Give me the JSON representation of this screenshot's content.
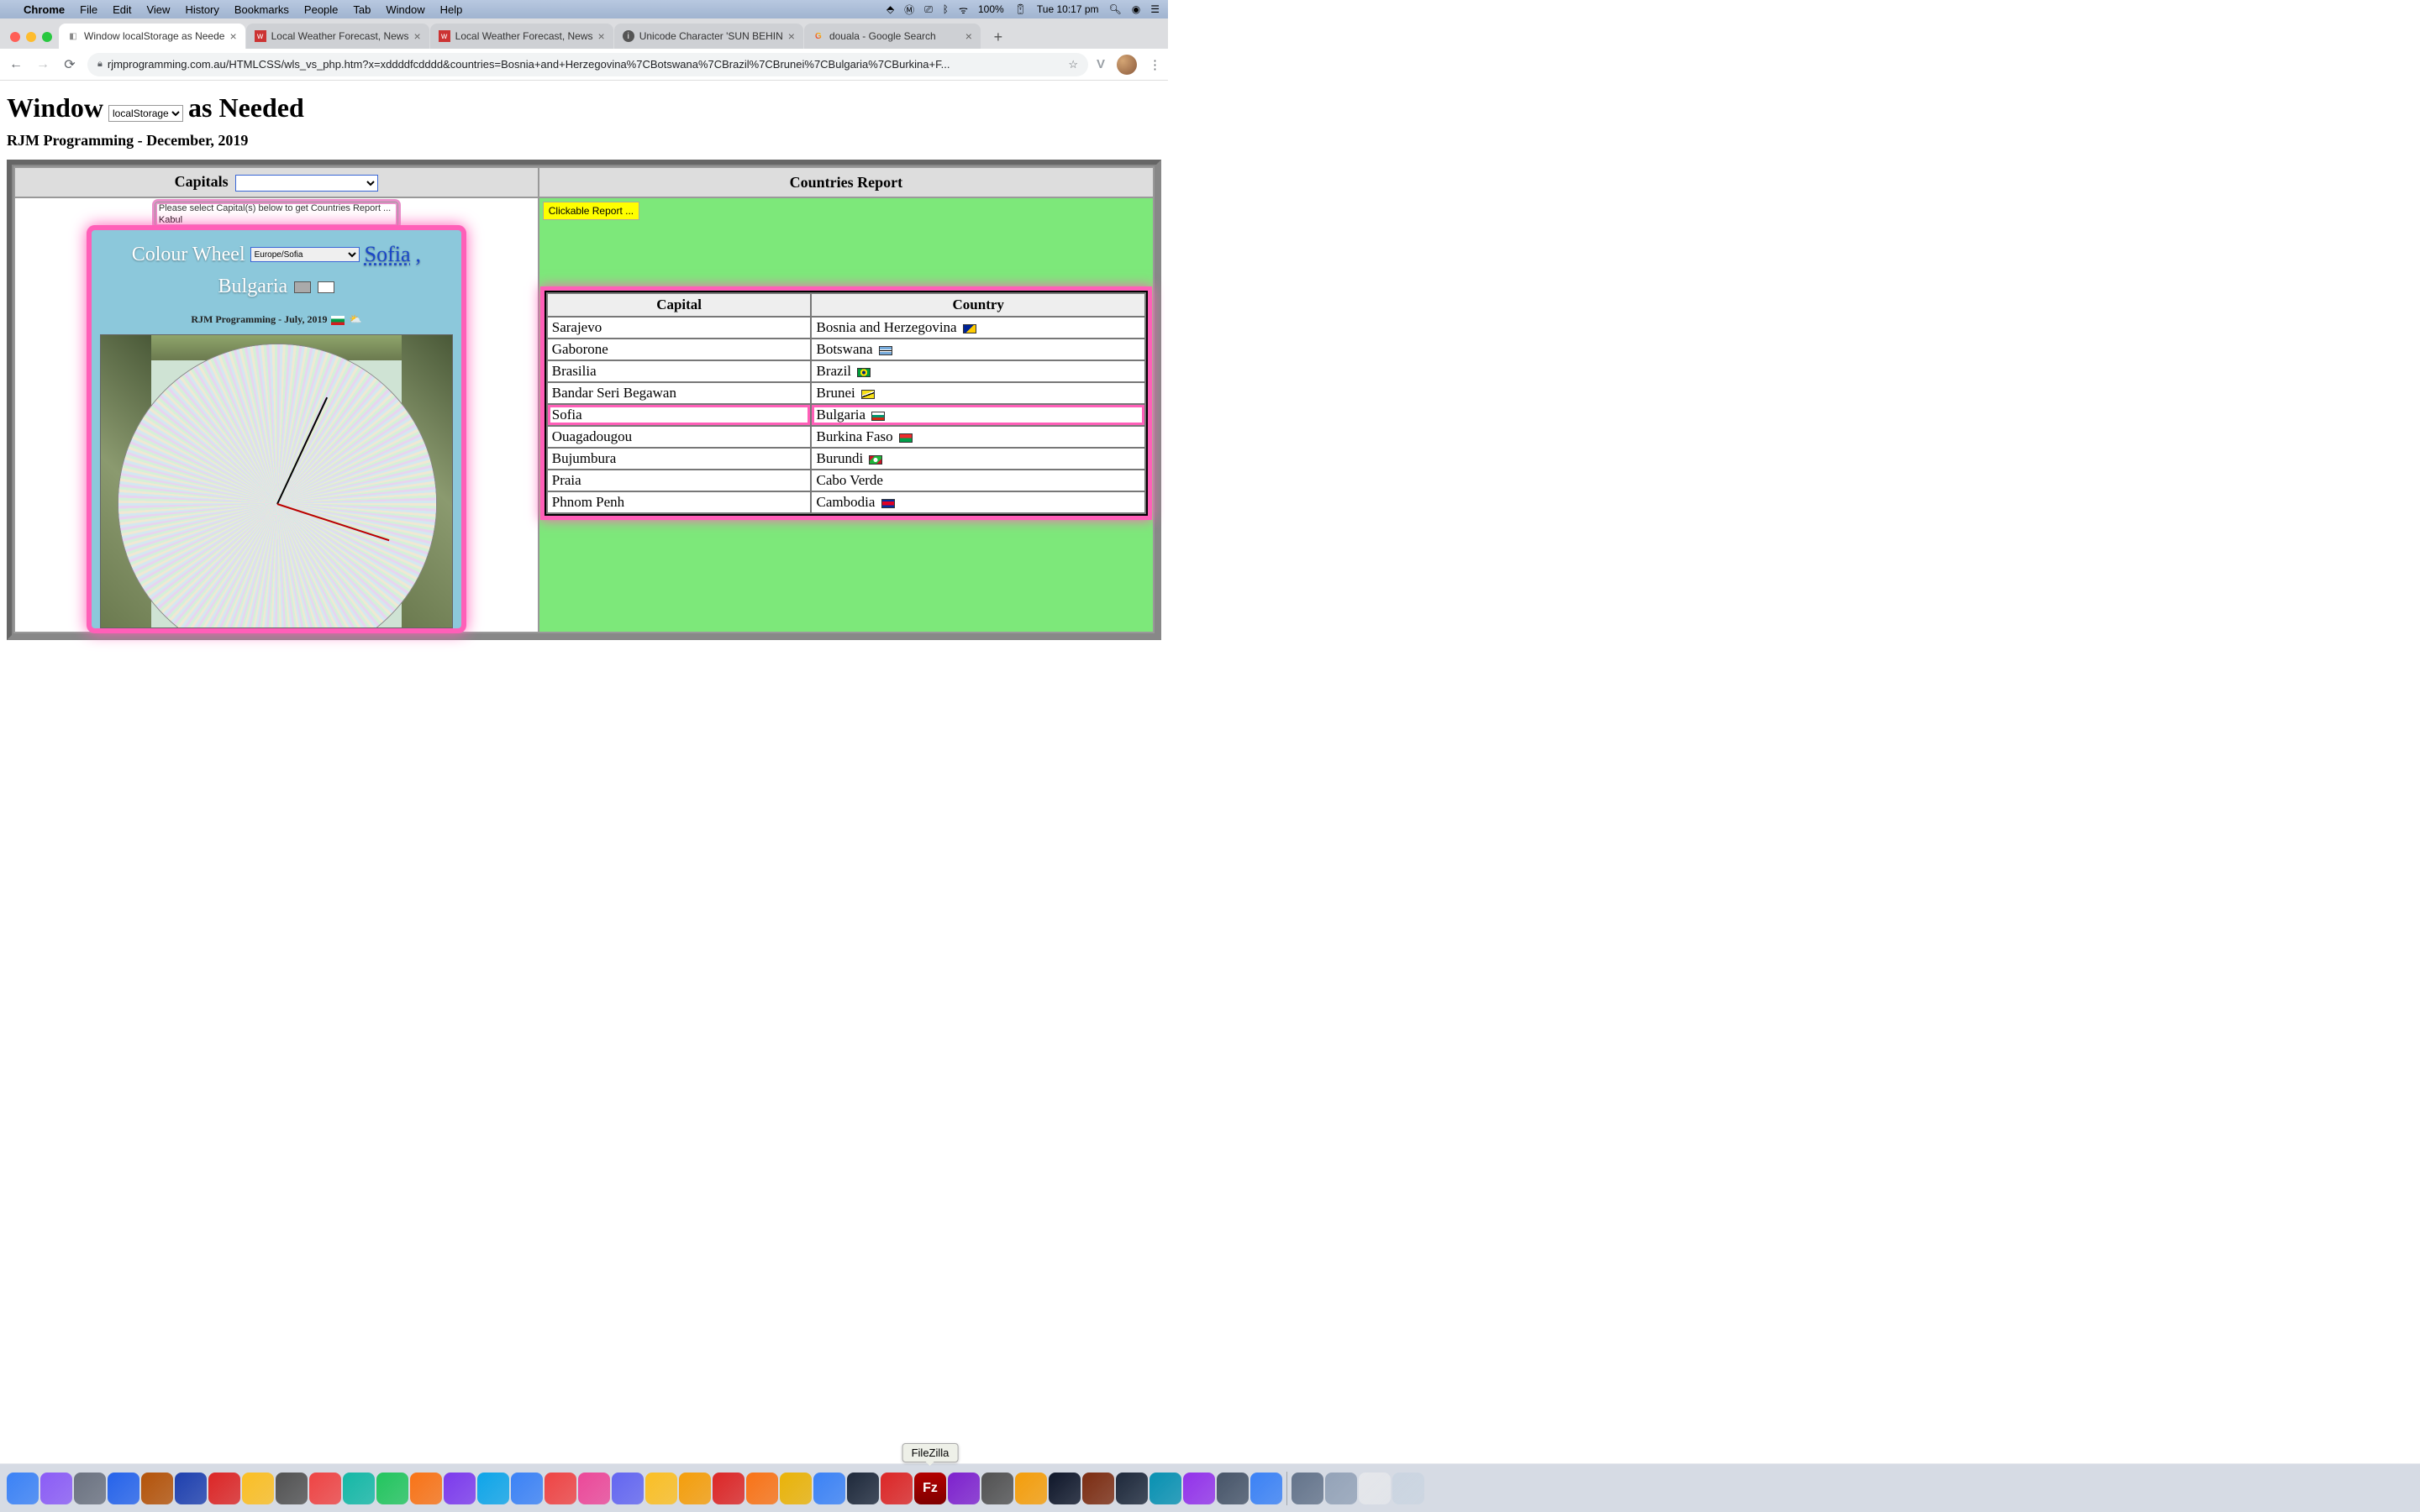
{
  "menubar": {
    "app": "Chrome",
    "items": [
      "File",
      "Edit",
      "View",
      "History",
      "Bookmarks",
      "People",
      "Tab",
      "Window",
      "Help"
    ],
    "battery": "100%",
    "clock": "Tue 10:17 pm"
  },
  "tabs": [
    {
      "label": "Window localStorage as Neede",
      "active": true,
      "icon": "page"
    },
    {
      "label": "Local Weather Forecast, News",
      "active": false,
      "icon": "wu"
    },
    {
      "label": "Local Weather Forecast, News",
      "active": false,
      "icon": "wu"
    },
    {
      "label": "Unicode Character 'SUN BEHIN",
      "active": false,
      "icon": "info"
    },
    {
      "label": "douala - Google Search",
      "active": false,
      "icon": "g"
    }
  ],
  "url": "rjmprogramming.com.au/HTMLCSS/wls_vs_php.htm?x=xddddfcdddd&countries=Bosnia+and+Herzegovina%7CBotswana%7CBrazil%7CBrunei%7CBulgaria%7CBurkina+F...",
  "page": {
    "title_pre": "Window",
    "title_select": "localStorage",
    "title_post": "as Needed",
    "subtitle": "RJM Programming - December, 2019",
    "capitals_header": "Capitals",
    "countries_header": "Countries Report",
    "capitals_placeholder": "",
    "capitals_hint": "Please select Capital(s) below to get Countries Report ...",
    "capitals_opt1": "Kabul",
    "wheel": {
      "title": "Colour Wheel",
      "tz_select": "Europe/Sofia",
      "city_link": "Sofia",
      "country": "Bulgaria",
      "attrib": "RJM Programming - July, 2019"
    },
    "clickable_badge": "Clickable Report ...",
    "report_headers": {
      "capital": "Capital",
      "country": "Country"
    },
    "rows": [
      {
        "capital": "Sarajevo",
        "country": "Bosnia and Herzegovina",
        "flag": "linear-gradient(135deg,#002395 50%,#fecb00 50%)"
      },
      {
        "capital": "Gaborone",
        "country": "Botswana",
        "flag": "linear-gradient(#75aadb 35%,#fff 35% 45%,#000 45% 55%,#fff 55% 65%,#75aadb 65%)"
      },
      {
        "capital": "Brasilia",
        "country": "Brazil",
        "flag": "radial-gradient(circle,#002776 25%,#fedf00 25% 50%,#009b3a 50%)"
      },
      {
        "capital": "Bandar Seri Begawan",
        "country": "Brunei",
        "flag": "linear-gradient(160deg,#f7e017 40%,#fff 40% 50%,#000 50% 60%,#f7e017 60%)"
      },
      {
        "capital": "Sofia",
        "country": "Bulgaria",
        "flag": "linear-gradient(#fff 33%,#00966e 33% 66%,#d62612 66%)",
        "hl": true
      },
      {
        "capital": "Ouagadougou",
        "country": "Burkina Faso",
        "flag": "linear-gradient(#ef2b2d 50%,#009e49 50%)"
      },
      {
        "capital": "Bujumbura",
        "country": "Burundi",
        "flag": "radial-gradient(circle,#fff 30%,transparent 30%),linear-gradient(135deg,#ce1126 25%,#1eb53a 25% 75%,#ce1126 75%)"
      },
      {
        "capital": "Praia",
        "country": "Cabo Verde",
        "flag": ""
      },
      {
        "capital": "Phnom Penh",
        "country": "Cambodia",
        "flag": "linear-gradient(#032ea1 25%,#e00025 25% 75%,#032ea1 75%)"
      }
    ]
  },
  "dock_tooltip": "FileZilla",
  "dock_colors": [
    "#3b82f6",
    "#8b5cf6",
    "#6b7280",
    "#2563eb",
    "#b45309",
    "#1e40af",
    "#dc2626",
    "#fbbf24",
    "#525252",
    "#ef4444",
    "#14b8a6",
    "#22c55e",
    "#f97316",
    "#7c3aed",
    "#0ea5e9",
    "#3b82f6",
    "#ef4444",
    "#ec4899",
    "#6366f1",
    "#fbbf24",
    "#f59e0b",
    "#dc2626",
    "#f97316",
    "#eab308",
    "#3b82f6",
    "#1e293b",
    "#dc2626",
    "#b91c1c",
    "#7e22ce",
    "#525252",
    "#f59e0b",
    "#0f172a",
    "#7c2d12",
    "#1e293b",
    "#0891b2",
    "#9333ea",
    "#475569",
    "#3b82f6",
    "#64748b",
    "#94a3b8",
    "#e5e7eb",
    "#cbd5e1"
  ]
}
